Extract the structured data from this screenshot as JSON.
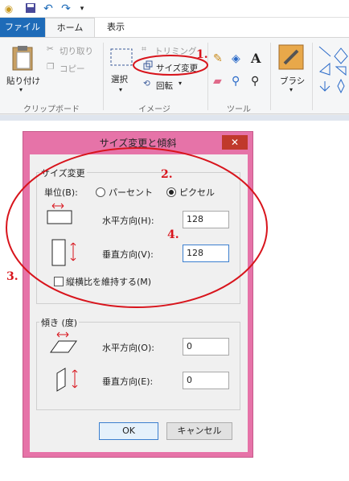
{
  "tabs": {
    "file": "ファイル",
    "home": "ホーム",
    "view": "表示"
  },
  "ribbon": {
    "clipboard": {
      "paste": "貼り付け",
      "cut": "切り取り",
      "copy": "コピー",
      "group": "クリップボード"
    },
    "image": {
      "select": "選択",
      "crop": "トリミング",
      "resize": "サイズ変更",
      "rotate": "回転",
      "group": "イメージ"
    },
    "tools": {
      "group": "ツール"
    },
    "brushes": {
      "label": "ブラシ"
    }
  },
  "dialog": {
    "title": "サイズ変更と傾斜",
    "close": "✕",
    "resize": {
      "legend": "サイズ変更",
      "unit_label": "単位(B):",
      "percent": "パーセント",
      "pixel": "ピクセル",
      "horizontal_label": "水平方向(H):",
      "horizontal_value": "128",
      "vertical_label": "垂直方向(V):",
      "vertical_value": "128",
      "keep_ratio": "縦横比を維持する(M)"
    },
    "skew": {
      "legend": "傾き (度)",
      "horizontal_label": "水平方向(O):",
      "horizontal_value": "0",
      "vertical_label": "垂直方向(E):",
      "vertical_value": "0"
    },
    "ok": "OK",
    "cancel": "キャンセル"
  },
  "annotations": {
    "a1": "1.",
    "a2": "2.",
    "a3": "3.",
    "a4": "4."
  },
  "colors": {
    "accent": "#1e6bb8",
    "dialog_border": "#e673a8",
    "annotation": "#d8141c"
  }
}
